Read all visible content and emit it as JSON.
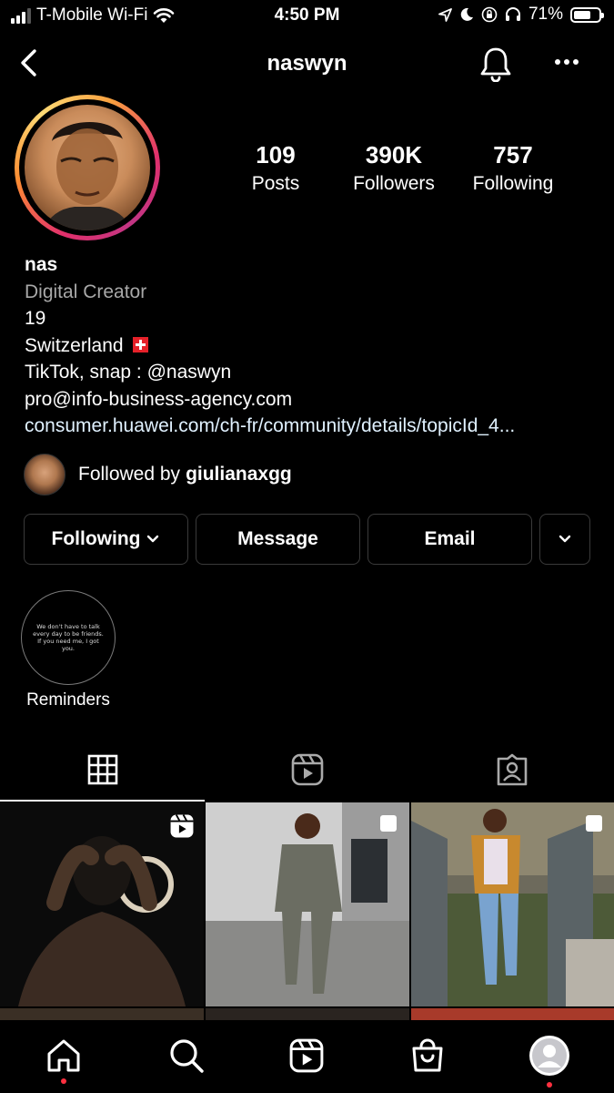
{
  "status_bar": {
    "carrier": "T-Mobile Wi-Fi",
    "time": "4:50 PM",
    "battery_percent": "71%",
    "battery_level": 0.71
  },
  "header": {
    "username": "naswyn"
  },
  "profile": {
    "stats": [
      {
        "value": "109",
        "label": "Posts"
      },
      {
        "value": "390K",
        "label": "Followers"
      },
      {
        "value": "757",
        "label": "Following"
      }
    ],
    "name": "nas",
    "category": "Digital Creator",
    "bio_lines": [
      "19",
      "Switzerland",
      "TikTok, snap : @naswyn",
      "pro@info-business-agency.com"
    ],
    "link": "consumer.huawei.com/ch-fr/community/details/topicId_4...",
    "followed_by_prefix": "Followed by",
    "followed_by_user": "giulianaxgg"
  },
  "actions": {
    "following_label": "Following",
    "message_label": "Message",
    "email_label": "Email"
  },
  "highlights": [
    {
      "label": "Reminders",
      "cover_text": "We don't have to talk every day to be friends. If you need me, I got you."
    }
  ],
  "tabs": [
    "grid-icon",
    "reels-icon",
    "tagged-icon"
  ],
  "nav": [
    "home-icon",
    "search-icon",
    "reels-icon",
    "shop-icon",
    "profile-icon"
  ],
  "colors": {
    "background": "#000000",
    "notification_dot": "#ff3040",
    "link": "#e0f1ff",
    "button_border": "#3a3a3a"
  }
}
